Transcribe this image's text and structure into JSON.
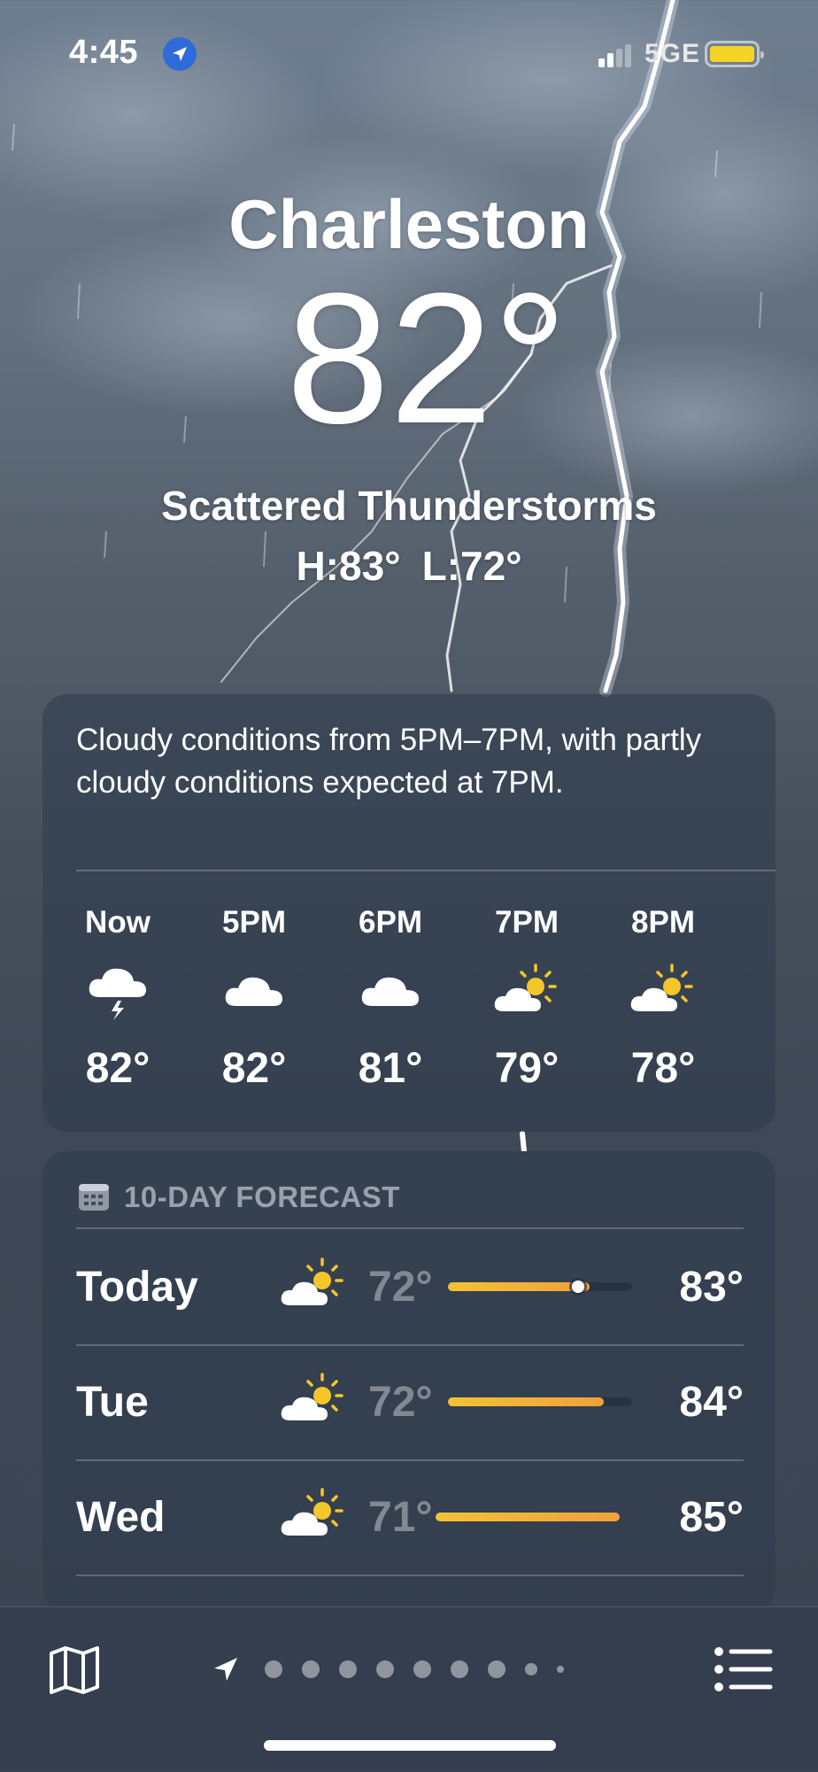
{
  "status_bar": {
    "time": "4:45",
    "network": "5GE",
    "battery_color": "#f5d327"
  },
  "location": {
    "city": "Charleston",
    "current_temp": "82°",
    "condition": "Scattered Thunderstorms",
    "high": "H:83°",
    "low": "L:72°"
  },
  "hourly": {
    "summary": "Cloudy conditions from 5PM–7PM, with partly cloudy conditions expected at 7PM.",
    "hours": [
      {
        "label": "Now",
        "icon": "thunderstorm-cloud-icon",
        "temp": "82°"
      },
      {
        "label": "5PM",
        "icon": "cloud-icon",
        "temp": "82°"
      },
      {
        "label": "6PM",
        "icon": "cloud-icon",
        "temp": "81°"
      },
      {
        "label": "7PM",
        "icon": "partly-sunny-icon",
        "temp": "79°"
      },
      {
        "label": "8PM",
        "icon": "partly-sunny-icon",
        "temp": "78°"
      }
    ]
  },
  "forecast": {
    "header": "10-DAY FORECAST",
    "days": [
      {
        "day": "Today",
        "icon": "partly-sunny-icon",
        "low": "72°",
        "high": "83°",
        "current_marker": true
      },
      {
        "day": "Tue",
        "icon": "partly-sunny-icon",
        "low": "72°",
        "high": "84°"
      },
      {
        "day": "Wed",
        "icon": "partly-sunny-icon",
        "low": "71°",
        "high": "85°"
      }
    ]
  },
  "bottom_bar": {
    "page_count": 9,
    "current_page": 0
  }
}
